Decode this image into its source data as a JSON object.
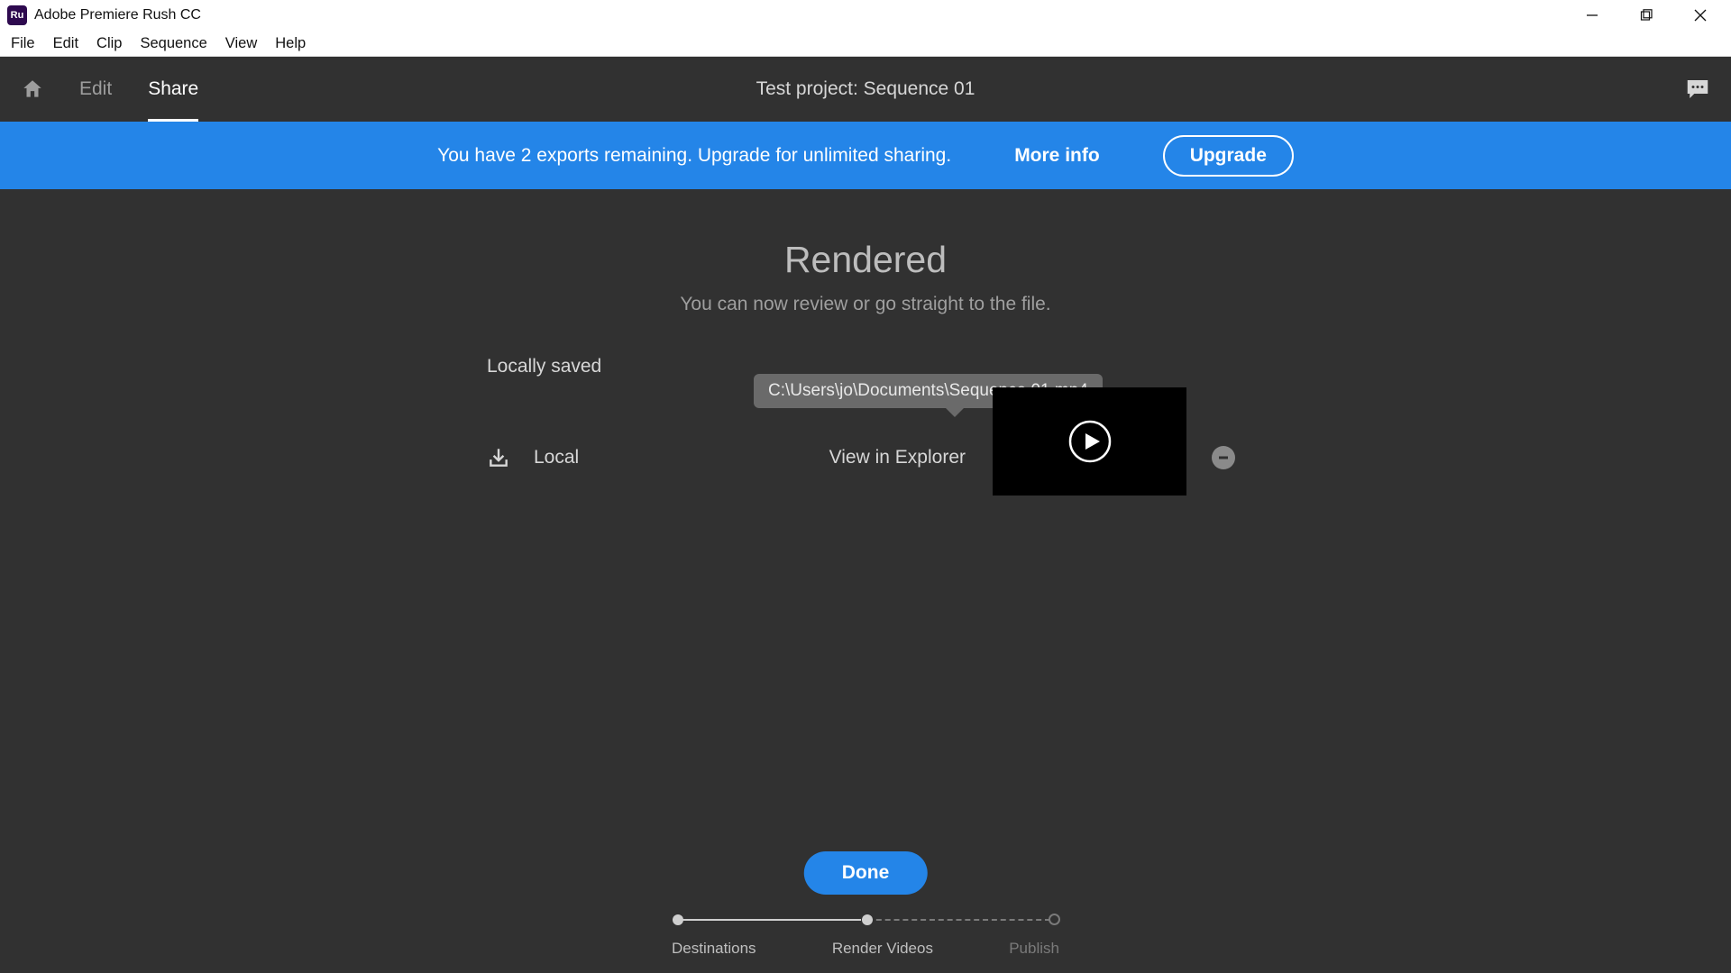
{
  "window": {
    "app_title": "Adobe Premiere Rush CC",
    "app_icon_label": "Ru"
  },
  "menu": {
    "items": [
      "File",
      "Edit",
      "Clip",
      "Sequence",
      "View",
      "Help"
    ]
  },
  "header": {
    "tabs": {
      "edit": "Edit",
      "share": "Share"
    },
    "project_title": "Test project: Sequence 01"
  },
  "banner": {
    "message": "You have 2 exports remaining. Upgrade for unlimited sharing.",
    "more_info": "More info",
    "upgrade": "Upgrade"
  },
  "main": {
    "title": "Rendered",
    "subtitle": "You can now review or go straight to the file.",
    "section_label": "Locally saved",
    "local_label": "Local",
    "view_link": "View in Explorer",
    "tooltip_path": "C:\\Users\\jo\\Documents\\Sequence 01.mp4",
    "done_label": "Done"
  },
  "stepper": {
    "step1": "Destinations",
    "step2": "Render Videos",
    "step3": "Publish"
  }
}
